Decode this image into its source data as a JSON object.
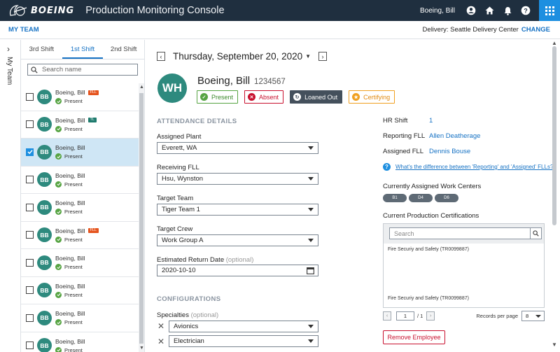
{
  "header": {
    "logo_word": "BOEING",
    "title": "Production Monitoring Console",
    "user": "Boeing, Bill",
    "icons": [
      "user-circle-icon",
      "home-icon",
      "bell-icon",
      "help-icon",
      "apps-grid-icon"
    ]
  },
  "teambar": {
    "label": "MY TEAM",
    "delivery": "Delivery: Seattle Delivery Center",
    "change": "CHANGE"
  },
  "rail": {
    "label": "My Team"
  },
  "shifts": {
    "tabs": [
      {
        "label": "3rd Shift",
        "active": false
      },
      {
        "label": "1st Shift",
        "active": true
      },
      {
        "label": "2nd Shift",
        "active": false
      }
    ],
    "search_placeholder": "Search name"
  },
  "employees": [
    {
      "initials": "BB",
      "name": "Boeing, Bill",
      "badge": "FLL",
      "status": "Present",
      "checked": false
    },
    {
      "initials": "BB",
      "name": "Boeing, Bill",
      "badge": "TL",
      "status": "Present",
      "checked": false
    },
    {
      "initials": "BB",
      "name": "Boeing, Bill",
      "badge": "",
      "status": "Present",
      "checked": true
    },
    {
      "initials": "BB",
      "name": "Boeing, Bill",
      "badge": "",
      "status": "Present",
      "checked": false
    },
    {
      "initials": "BB",
      "name": "Boeing, Bill",
      "badge": "",
      "status": "Present",
      "checked": false
    },
    {
      "initials": "BB",
      "name": "Boeing, Bill",
      "badge": "FLL",
      "status": "Present",
      "checked": false
    },
    {
      "initials": "BB",
      "name": "Boeing, Bill",
      "badge": "",
      "status": "Present",
      "checked": false
    },
    {
      "initials": "BB",
      "name": "Boeing, Bill",
      "badge": "",
      "status": "Present",
      "checked": false
    },
    {
      "initials": "BB",
      "name": "Boeing, Bill",
      "badge": "",
      "status": "Present",
      "checked": false
    },
    {
      "initials": "BB",
      "name": "Boeing, Bill",
      "badge": "",
      "status": "Present",
      "checked": false
    }
  ],
  "detail": {
    "date": "Thursday, September 20, 2020",
    "initials": "WH",
    "name": "Boeing, Bill",
    "id": "1234567",
    "statuses": {
      "present": "Present",
      "absent": "Absent",
      "loaned": "Loaned Out",
      "certifying": "Certifying"
    },
    "attendance_title": "ATTENDANCE DETAILS",
    "assigned_plant_label": "Assigned Plant",
    "assigned_plant": "Everett, WA",
    "receiving_fll_label": "Receiving FLL",
    "receiving_fll": "Hsu, Wynston",
    "target_team_label": "Target Team",
    "target_team": "Tiger Team 1",
    "target_crew_label": "Target Crew",
    "target_crew": "Work Group A",
    "return_date_label": "Estimated Return Date",
    "return_date_optional": "(optional)",
    "return_date": "2020-10-10",
    "config_title": "CONFIGURATIONS",
    "specialties_label": "Specialties",
    "specialties_optional": "(optional)",
    "specialties": [
      "Avionics",
      "Electrician"
    ]
  },
  "info": {
    "hr_shift_label": "HR Shift",
    "hr_shift": "1",
    "reporting_fll_label": "Reporting FLL",
    "reporting_fll": "Allen Deatherage",
    "assigned_fll_label": "Assigned FLL",
    "assigned_fll": "Dennis Bouse",
    "help_link": "What's the difference between 'Reporting' and 'Assigned' FLLs?",
    "work_centers_title": "Currently Assigned Work Centers",
    "work_centers": [
      "B1",
      "D4",
      "D6"
    ],
    "certs_title": "Current Production Certifications",
    "certs_search_placeholder": "Search",
    "certs": [
      "Fire Securiy and Safety (TR0099887)",
      "Fire Securiy and Safety (TR0099887)"
    ],
    "page": "1",
    "page_of": "/ 1",
    "records_label": "Records per page",
    "records_value": "8",
    "remove_label": "Remove Employee"
  },
  "colors": {
    "topbar": "#1f2f3f",
    "accent": "#1672c4",
    "avatar": "#2e8a7e",
    "present": "#57a443",
    "absent": "#c8102e",
    "certifying": "#f0a020"
  }
}
